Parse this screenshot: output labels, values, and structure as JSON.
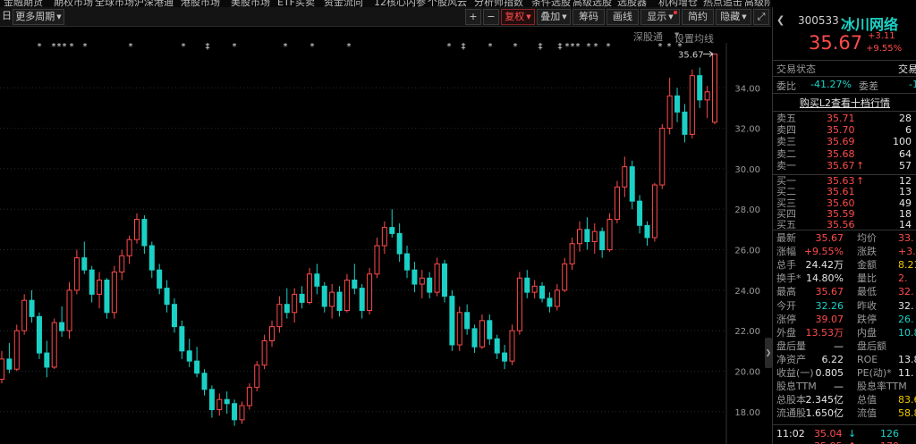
{
  "top_menu": [
    "金融期货",
    "期权市场",
    "全球市场",
    "沪深港通",
    "港股市场",
    "美股市场",
    "ETF买卖",
    "资金流向",
    "12核心内参",
    "个股风云",
    "分析师指数",
    "条件选股",
    "高级选股",
    "选股器",
    "机构增仓",
    "热点追击",
    "高级阶段"
  ],
  "toolbar": {
    "period_label": "日线",
    "more_period": "更多周期",
    "add": "+",
    "minus": "−",
    "fq": "复权",
    "overlay": "叠加",
    "chips": "筹码",
    "draw": "画线",
    "display": "显示",
    "simple": "简约",
    "hide": "隐藏"
  },
  "sub_header": {
    "shentong": "深股通",
    "ma_settings": "设置均线"
  },
  "chart_data": {
    "type": "candlestick",
    "y_ticks": [
      18,
      20,
      22,
      24,
      26,
      28,
      30,
      32,
      34
    ],
    "y_tick_labels": [
      "18.00",
      "20.00",
      "22.00",
      "24.00",
      "26.00",
      "28.00",
      "30.00",
      "32.00",
      "34.00"
    ],
    "ylim": [
      16.8,
      35.6
    ],
    "last_price_label": "35.67",
    "markers": [
      "*",
      "*",
      "*",
      "*",
      "*",
      "*",
      "*",
      "*",
      "‡",
      "*",
      "*",
      "*",
      "*",
      "*",
      "‡",
      "*",
      "*",
      "‡",
      "‡",
      "*",
      "*",
      "*",
      "*",
      "*",
      "*",
      "*",
      "*",
      "*"
    ],
    "candles": [
      [
        19.6,
        21.0,
        19.4,
        20.6
      ],
      [
        20.6,
        21.4,
        19.9,
        20.1
      ],
      [
        20.1,
        22.3,
        20.0,
        22.0
      ],
      [
        22.0,
        23.8,
        21.8,
        23.5
      ],
      [
        23.5,
        24.0,
        22.4,
        22.7
      ],
      [
        22.7,
        22.9,
        20.6,
        20.9
      ],
      [
        20.9,
        21.5,
        19.7,
        20.2
      ],
      [
        20.2,
        22.6,
        20.1,
        22.4
      ],
      [
        22.4,
        23.2,
        21.7,
        22.0
      ],
      [
        22.0,
        24.4,
        21.6,
        24.0
      ],
      [
        24.0,
        26.0,
        23.8,
        25.6
      ],
      [
        25.6,
        26.4,
        24.8,
        25.0
      ],
      [
        25.0,
        25.2,
        23.4,
        23.8
      ],
      [
        23.8,
        24.9,
        23.1,
        24.5
      ],
      [
        24.5,
        24.6,
        22.6,
        22.9
      ],
      [
        22.9,
        25.2,
        22.6,
        24.9
      ],
      [
        24.9,
        26.0,
        24.5,
        25.7
      ],
      [
        25.7,
        26.7,
        25.3,
        26.5
      ],
      [
        26.5,
        27.8,
        26.3,
        27.5
      ],
      [
        27.5,
        27.7,
        25.8,
        26.2
      ],
      [
        26.2,
        26.4,
        24.6,
        25.0
      ],
      [
        25.0,
        25.3,
        23.8,
        24.1
      ],
      [
        24.1,
        24.5,
        22.9,
        23.3
      ],
      [
        23.3,
        23.6,
        21.9,
        22.2
      ],
      [
        22.2,
        22.5,
        20.6,
        21.0
      ],
      [
        21.0,
        21.6,
        20.2,
        20.5
      ],
      [
        20.5,
        21.2,
        19.7,
        19.9
      ],
      [
        19.9,
        20.1,
        18.8,
        19.1
      ],
      [
        19.1,
        19.3,
        17.7,
        18.1
      ],
      [
        18.1,
        18.9,
        17.8,
        18.6
      ],
      [
        18.6,
        19.0,
        17.9,
        18.4
      ],
      [
        18.4,
        18.6,
        17.3,
        17.6
      ],
      [
        17.6,
        18.5,
        17.4,
        18.3
      ],
      [
        18.3,
        19.4,
        18.1,
        19.2
      ],
      [
        19.2,
        20.5,
        19.0,
        20.3
      ],
      [
        20.3,
        21.8,
        20.1,
        21.5
      ],
      [
        21.5,
        22.5,
        21.2,
        22.2
      ],
      [
        22.2,
        23.7,
        21.9,
        23.3
      ],
      [
        23.3,
        24.1,
        22.6,
        22.9
      ],
      [
        22.9,
        24.1,
        22.4,
        23.8
      ],
      [
        23.8,
        24.2,
        23.1,
        23.4
      ],
      [
        23.4,
        25.1,
        23.3,
        24.8
      ],
      [
        24.8,
        25.3,
        23.8,
        24.2
      ],
      [
        24.2,
        24.4,
        22.9,
        23.2
      ],
      [
        23.2,
        24.3,
        22.6,
        23.9
      ],
      [
        23.9,
        24.2,
        22.7,
        23.0
      ],
      [
        23.0,
        24.8,
        22.9,
        24.5
      ],
      [
        24.5,
        25.3,
        23.8,
        24.1
      ],
      [
        24.1,
        24.3,
        22.6,
        23.0
      ],
      [
        23.0,
        25.1,
        22.8,
        24.8
      ],
      [
        24.8,
        26.6,
        24.6,
        26.2
      ],
      [
        26.2,
        27.4,
        25.8,
        27.1
      ],
      [
        27.1,
        28.0,
        26.6,
        26.8
      ],
      [
        26.8,
        27.3,
        25.4,
        25.8
      ],
      [
        25.8,
        26.2,
        24.6,
        25.0
      ],
      [
        25.0,
        25.4,
        23.9,
        24.3
      ],
      [
        24.3,
        25.0,
        23.6,
        24.6
      ],
      [
        24.6,
        24.9,
        23.6,
        23.9
      ],
      [
        23.9,
        25.6,
        23.7,
        25.3
      ],
      [
        25.3,
        25.5,
        23.4,
        23.7
      ],
      [
        23.7,
        24.0,
        21.0,
        21.3
      ],
      [
        21.3,
        23.2,
        21.0,
        22.9
      ],
      [
        22.9,
        23.3,
        21.8,
        22.1
      ],
      [
        22.1,
        22.3,
        20.9,
        21.2
      ],
      [
        21.2,
        22.8,
        21.1,
        22.5
      ],
      [
        22.5,
        22.8,
        21.3,
        21.6
      ],
      [
        21.6,
        21.8,
        20.6,
        20.9
      ],
      [
        20.9,
        21.3,
        20.1,
        20.5
      ],
      [
        20.5,
        22.3,
        20.3,
        22.0
      ],
      [
        22.0,
        24.9,
        21.8,
        24.6
      ],
      [
        24.6,
        25.0,
        23.6,
        23.9
      ],
      [
        23.9,
        24.5,
        23.6,
        24.2
      ],
      [
        24.2,
        24.4,
        23.4,
        23.6
      ],
      [
        23.6,
        23.9,
        22.9,
        23.2
      ],
      [
        23.2,
        24.3,
        23.0,
        24.0
      ],
      [
        24.0,
        25.6,
        23.9,
        25.3
      ],
      [
        25.3,
        26.6,
        25.0,
        26.3
      ],
      [
        26.3,
        27.4,
        25.9,
        27.0
      ],
      [
        27.0,
        27.6,
        26.0,
        26.4
      ],
      [
        26.4,
        27.3,
        25.8,
        26.9
      ],
      [
        26.9,
        27.1,
        25.6,
        26.0
      ],
      [
        26.0,
        27.8,
        25.9,
        27.5
      ],
      [
        27.5,
        29.4,
        27.3,
        29.1
      ],
      [
        29.1,
        30.6,
        28.6,
        30.1
      ],
      [
        30.1,
        30.4,
        28.0,
        28.4
      ],
      [
        28.4,
        28.7,
        26.8,
        27.2
      ],
      [
        27.2,
        27.4,
        26.2,
        26.6
      ],
      [
        26.6,
        29.3,
        26.4,
        29.2
      ],
      [
        29.2,
        32.2,
        29.0,
        32.0
      ],
      [
        32.0,
        34.5,
        31.7,
        33.6
      ],
      [
        33.6,
        34.0,
        32.3,
        32.8
      ],
      [
        32.8,
        33.2,
        31.3,
        31.7
      ],
      [
        31.7,
        34.9,
        31.5,
        34.6
      ],
      [
        34.6,
        35.0,
        33.0,
        33.4
      ],
      [
        33.4,
        34.1,
        32.5,
        33.8
      ],
      [
        32.3,
        35.67,
        32.2,
        35.67
      ]
    ]
  },
  "panel": {
    "code": "300533",
    "name": "冰川网络",
    "price": "35.67",
    "change": "+3.11",
    "change_pct": "+9.55%",
    "trade_status": "交易状态",
    "trade_status_right": "交易",
    "weibi_label": "委比",
    "weibi_value": "-41.27%",
    "weicha_label": "委差",
    "weicha_value": "-1",
    "l2_link": "购买L2查看十档行情",
    "sell": [
      {
        "label": "卖五",
        "price": "35.71",
        "vol": "28",
        "flag": ""
      },
      {
        "label": "卖四",
        "price": "35.70",
        "vol": "6",
        "flag": ""
      },
      {
        "label": "卖三",
        "price": "35.69",
        "vol": "100",
        "flag": ""
      },
      {
        "label": "卖二",
        "price": "35.68",
        "vol": "64",
        "flag": ""
      },
      {
        "label": "卖一",
        "price": "35.67",
        "vol": "57",
        "flag": "↑"
      }
    ],
    "buy": [
      {
        "label": "买一",
        "price": "35.63",
        "vol": "12",
        "flag": "↑"
      },
      {
        "label": "买二",
        "price": "35.61",
        "vol": "13",
        "flag": ""
      },
      {
        "label": "买三",
        "price": "35.60",
        "vol": "49",
        "flag": ""
      },
      {
        "label": "买四",
        "price": "35.59",
        "vol": "18",
        "flag": ""
      },
      {
        "label": "买五",
        "price": "35.56",
        "vol": "14",
        "flag": ""
      }
    ],
    "stats": [
      {
        "l1": "最新",
        "v1": "35.67",
        "c1": "red",
        "l2": "均价",
        "v2": "33.",
        "c2": "red"
      },
      {
        "l1": "涨幅",
        "v1": "+9.55%",
        "c1": "red",
        "l2": "涨跌",
        "v2": "+3.",
        "c2": "red"
      },
      {
        "l1": "总手",
        "v1": "24.42万",
        "c1": "white",
        "l2": "金额",
        "v2": "8.21",
        "c2": "yellow"
      },
      {
        "l1": "换手*",
        "v1": "14.80%",
        "c1": "white",
        "l2": "量比",
        "v2": "2.",
        "c2": "red"
      },
      {
        "l1": "最高",
        "v1": "35.67",
        "c1": "red",
        "l2": "最低",
        "v2": "32.",
        "c2": "red"
      },
      {
        "l1": "今开",
        "v1": "32.26",
        "c1": "green",
        "l2": "昨收",
        "v2": "32.",
        "c2": "white"
      },
      {
        "l1": "涨停",
        "v1": "39.07",
        "c1": "red",
        "l2": "跌停",
        "v2": "26.",
        "c2": "green"
      },
      {
        "l1": "外盘",
        "v1": "13.53万",
        "c1": "red",
        "l2": "内盘",
        "v2": "10.89",
        "c2": "green"
      },
      {
        "l1": "盘后量",
        "v1": "—",
        "c1": "white",
        "l2": "盘后额",
        "v2": "",
        "c2": "white"
      },
      {
        "l1": "净资产",
        "v1": "6.22",
        "c1": "white",
        "l2": "ROE",
        "v2": "13.8",
        "c2": "white"
      },
      {
        "l1": "收益(一)",
        "v1": "0.805",
        "c1": "white",
        "l2": "PE(动)*",
        "v2": "11.",
        "c2": "white"
      },
      {
        "l1": "股息TTM",
        "v1": "—",
        "c1": "white",
        "l2": "股息率TTM",
        "v2": "",
        "c2": "white"
      },
      {
        "l1": "总股本",
        "v1": "2.345亿",
        "c1": "white",
        "l2": "总值",
        "v2": "83.63",
        "c2": "yellow"
      },
      {
        "l1": "流通股",
        "v1": "1.650亿",
        "c1": "white",
        "l2": "流值",
        "v2": "58.85",
        "c2": "yellow"
      }
    ],
    "ticks": [
      {
        "time": "11:02",
        "price": "35.04",
        "arrow": "↓",
        "vol": "126"
      },
      {
        "time": "",
        "price": "35.05",
        "arrow": "↑",
        "vol": "170"
      }
    ]
  },
  "colors": {
    "up": "#ff4b4b",
    "down": "#1bd1c6",
    "grid": "#2a2a2a",
    "bg": "#000000"
  }
}
